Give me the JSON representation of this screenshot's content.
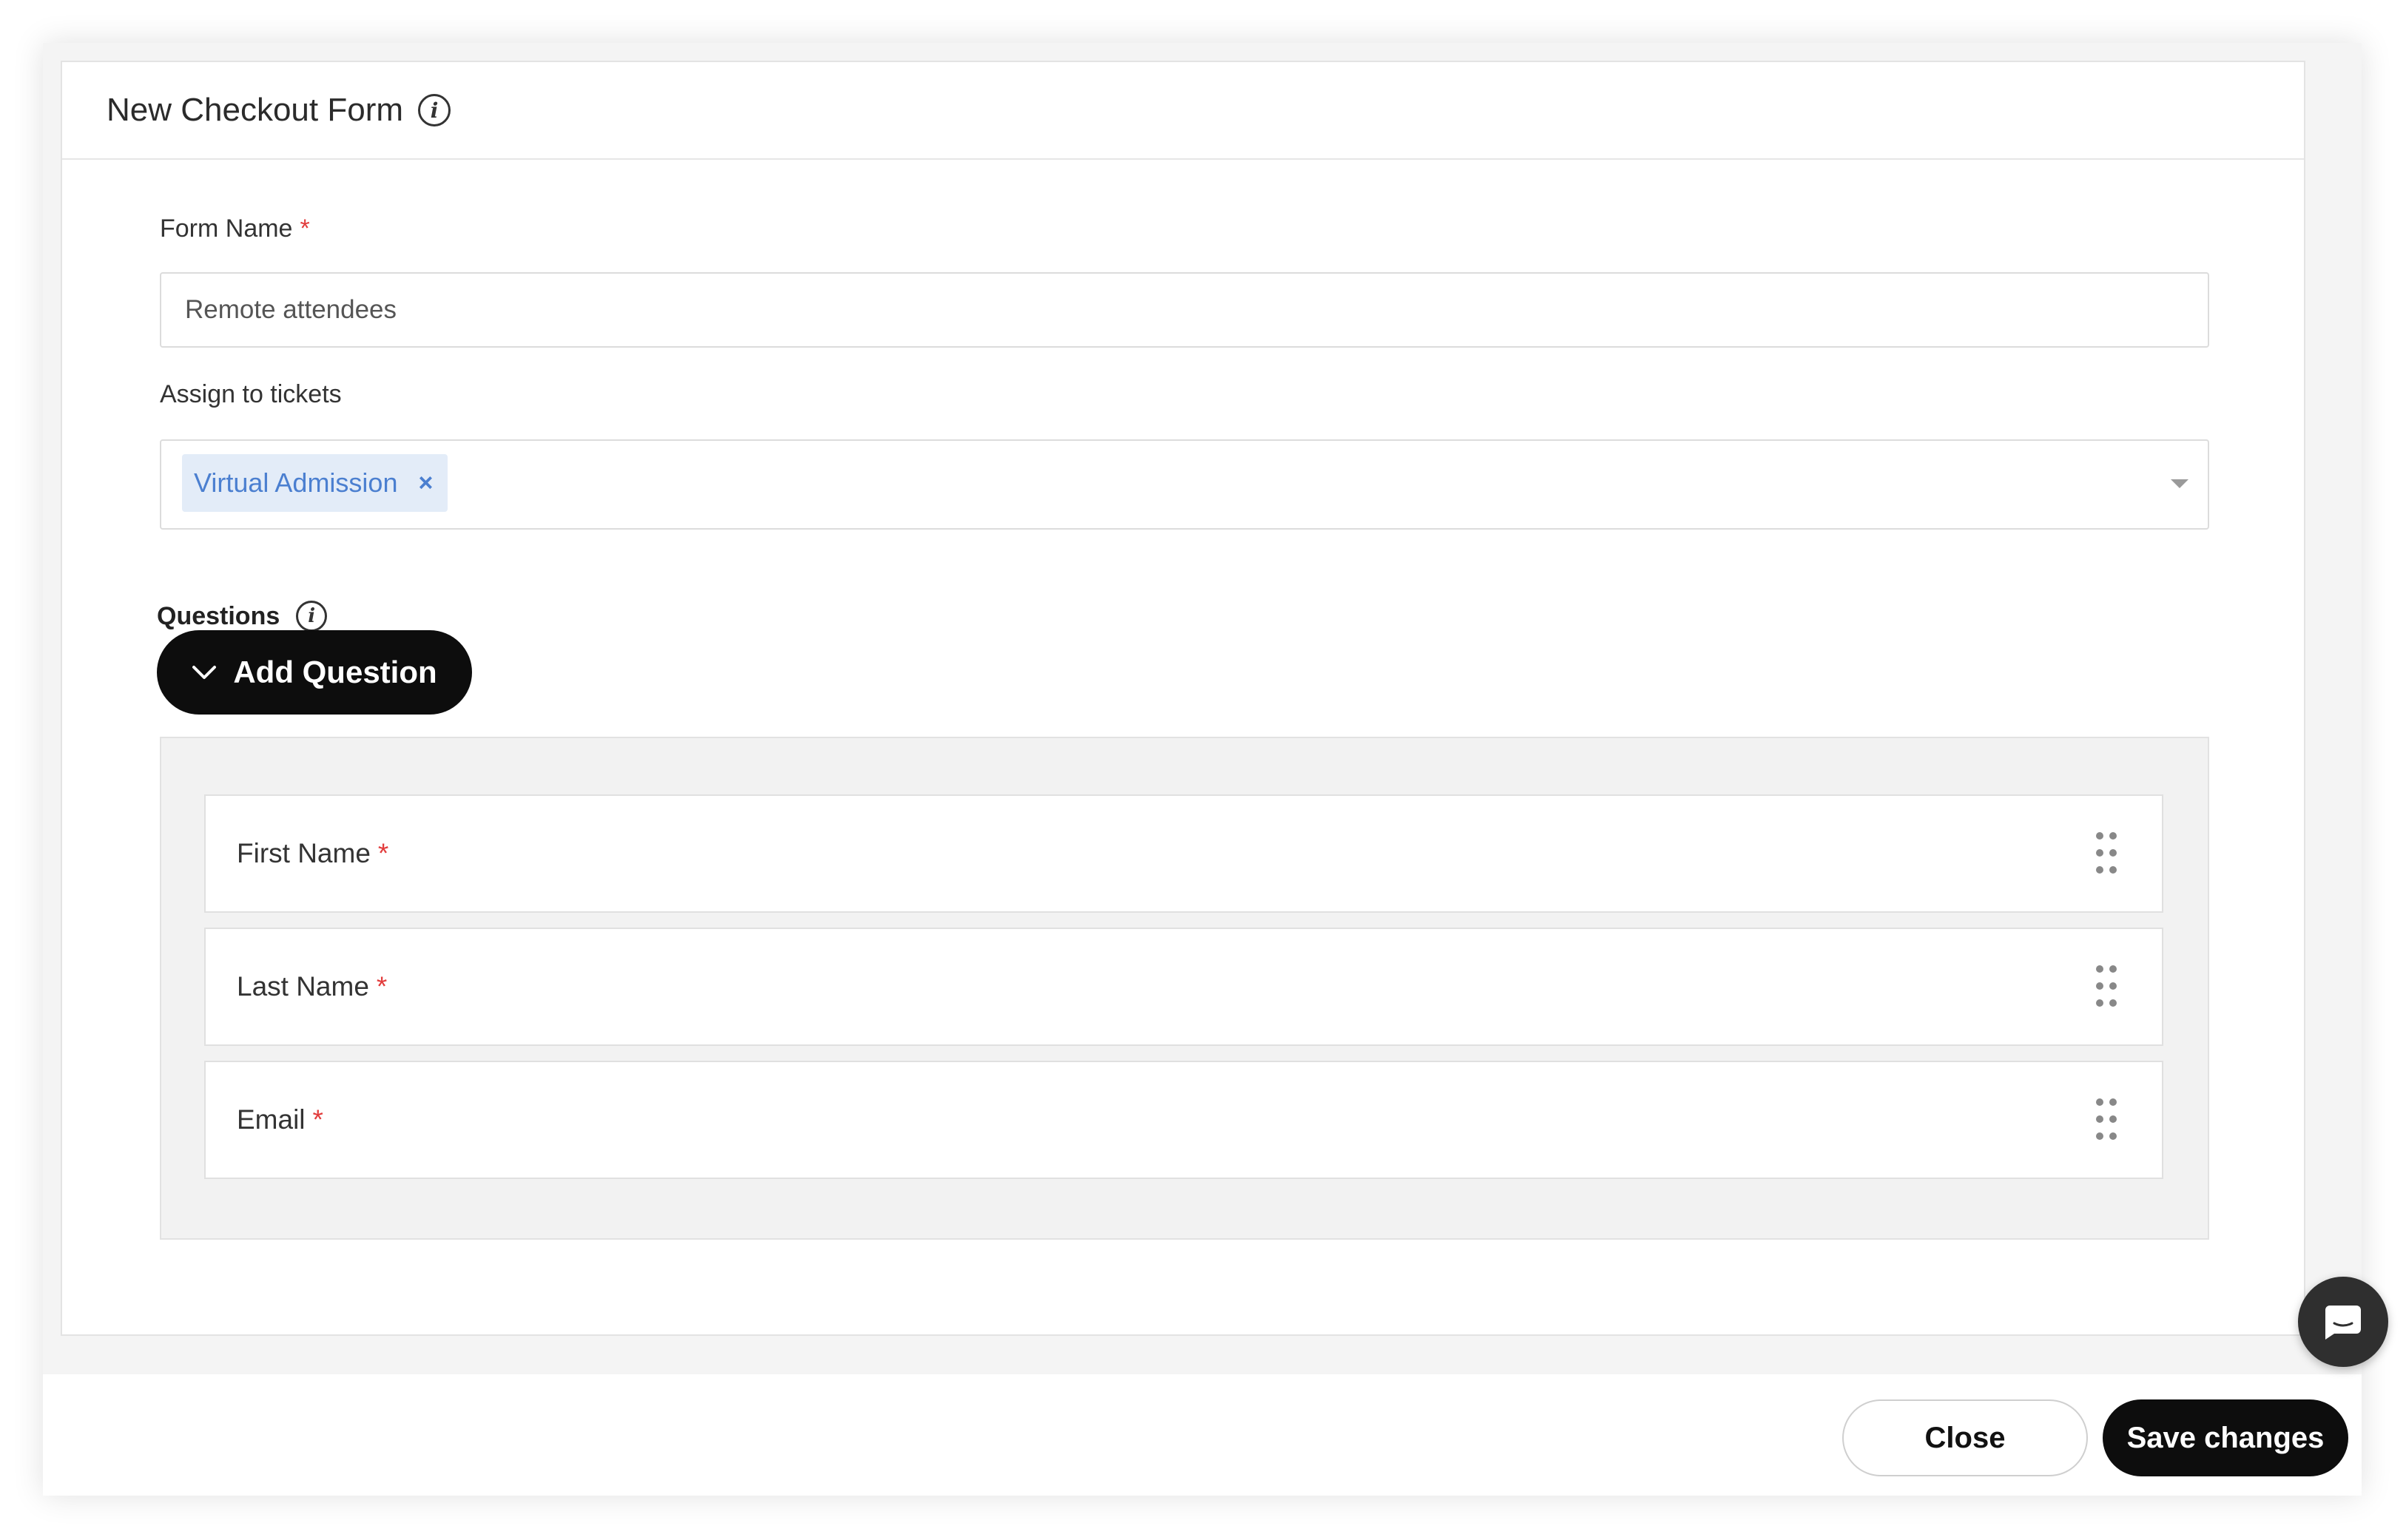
{
  "modal": {
    "title": "New Checkout Form",
    "title_info_icon": "info-icon"
  },
  "form_name": {
    "label": "Form Name",
    "required_marker": "*",
    "value": "Remote attendees"
  },
  "assign_tickets": {
    "label": "Assign to tickets",
    "selected_tags": [
      {
        "label": "Virtual Admission",
        "remove_glyph": "×"
      }
    ]
  },
  "questions": {
    "label": "Questions",
    "info_icon": "info-icon",
    "add_button_label": "Add Question",
    "items": [
      {
        "label": "First Name",
        "required_marker": "*"
      },
      {
        "label": "Last Name",
        "required_marker": "*"
      },
      {
        "label": "Email",
        "required_marker": "*"
      }
    ]
  },
  "footer": {
    "close_label": "Close",
    "save_label": "Save changes"
  },
  "colors": {
    "primary_button": "#0d0d0d",
    "required": "#e23c3c",
    "tag_background": "#e3ecf8",
    "tag_text": "#4b7fd0"
  }
}
